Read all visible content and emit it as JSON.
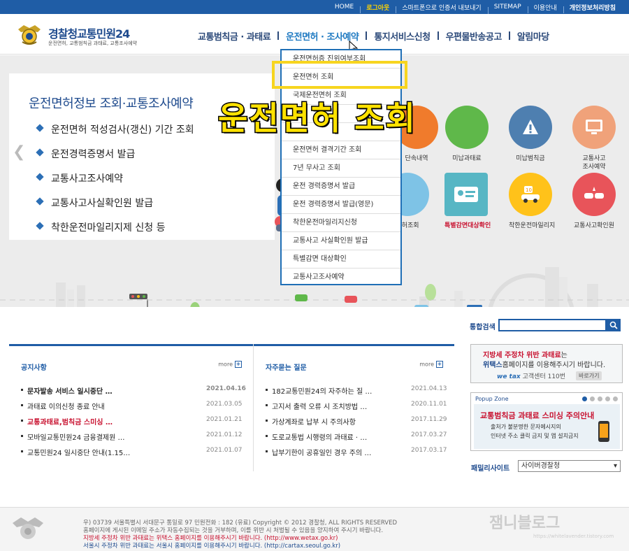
{
  "topbar": {
    "items": [
      "HOME",
      "로그아웃",
      "스마트폰으로 인증서 내보내기",
      "SITEMAP",
      "이용안내",
      "개인정보처리방침"
    ]
  },
  "logo": {
    "prefix": "경찰청",
    "name": "교통민원24",
    "sub": "운전면허, 교통범칙금 과태료, 교통조사예약"
  },
  "gnb": [
    "교통범칙금 · 과태료",
    "운전면허 · 조사예약",
    "통지서비스신청",
    "우편물반송공고",
    "알림마당"
  ],
  "hero": {
    "title": "운전면허정보 조회·교통조사예약",
    "items": [
      "운전면허 적성검사(갱신) 기간 조회",
      "운전경력증명서 발급",
      "교통사고조사예약",
      "교통사고사실확인원 발급",
      "착한운전마일리지제 신청 등"
    ]
  },
  "icons": [
    {
      "label": "단속내역",
      "color": "#f07b2c"
    },
    {
      "label": "미납과태료",
      "color": "#5fb84a"
    },
    {
      "label": "미납범칙금",
      "color": "#4e7fb0"
    },
    {
      "label": "교통사고\n조사예약",
      "color": "#f0a27a"
    },
    {
      "label": "면허조회",
      "color": "#7ec3e6"
    },
    {
      "label": "특별감면대상확인",
      "color": "#57b6c4",
      "red": true
    },
    {
      "label": "착한운전마일리지",
      "color": "#ffc21a"
    },
    {
      "label": "교통사고확인원",
      "color": "#e8545a"
    }
  ],
  "dropdown": [
    "운전면허증 진위여부조회",
    "운전면허 조회",
    "국제운전면허 조회",
    "",
    "",
    "운전면허 결격기간 조회",
    "7년 무사고 조회",
    "운전 경력증명서 발급",
    "운전 경력증명서 발급(영문)",
    "착한운전마일리지신청",
    "교통사고 사실확인원 발급",
    "특별감면 대상확인",
    "교통사고조사예약"
  ],
  "overlay": "운전면허 조회",
  "notice": {
    "title": "공지사항",
    "more": "more",
    "items": [
      {
        "text": "문자발송 서비스 일시중단 …",
        "date": "2021.04.16",
        "bold": true
      },
      {
        "text": "과태료 이의신청 종료 안내",
        "date": "2021.03.05"
      },
      {
        "text": "교통과태료,범칙금 스미싱 …",
        "date": "2021.01.21",
        "red": true
      },
      {
        "text": "모바일교통민원24 금융결제원 …",
        "date": "2021.01.12"
      },
      {
        "text": "교통민원24 일시중단 안내(1.15…",
        "date": "2021.01.07"
      }
    ]
  },
  "faq": {
    "title": "자주묻는 질문",
    "more": "more",
    "items": [
      {
        "text": "182교통민원24의 자주하는 질 …",
        "date": "2021.04.13"
      },
      {
        "text": "고지서 출력 오류 시 조치방법 …",
        "date": "2020.11.01"
      },
      {
        "text": "가상계좌로 납부 시 주의사항",
        "date": "2017.11.29"
      },
      {
        "text": "도로교통법 시행령의 과태료 · …",
        "date": "2017.03.27"
      },
      {
        "text": "납부기한이 공휴일인 경우 주의 …",
        "date": "2017.03.17"
      }
    ]
  },
  "search": {
    "label": "통합검색",
    "placeholder": ""
  },
  "ad": {
    "line1_red": "지방세 주정차 위반 과태료",
    "line1_rest": "는",
    "line2_bold": "위택스",
    "line2_rest": "홈페이지를 이용해주시기 바랍니다.",
    "brand": "we tax",
    "center": "고객센터 110번",
    "button": "바로가기"
  },
  "popup": {
    "title": "Popup Zone",
    "headline": "교통범칙금 과태료 스미싱 주의안내",
    "text1": "출처가 불분명한 문자메시지의",
    "text2": "인터넷 주소 클릭 금지 및 앱 설치금지"
  },
  "family": {
    "label": "패밀리사이트",
    "value": "사이버경찰청"
  },
  "footer": {
    "line1": "우) 03739 서울특별시 서대문구 통일로 97  민원전화 : 182 (유료)      Copyright © 2012 경찰청, ALL RIGHTS RESERVED",
    "line2": "홈페이지에 게시된 이메일 주소가 자동수집되는 것을 거부하며, 이를 위반 시 처벌될 수 있음을 양지하여 주시기 바랍니다.",
    "line3": "지방세 주정차 위반 과태료는 위택스 홈페이지를 이용해주시기 바랍니다. (http://www.wetax.go.kr)",
    "line4": "서울시 주정차 위반 과태료는 서울시 홈페이지를 이용해주시기 바랍니다. (http://cartax.seoul.go.kr)"
  },
  "watermark": {
    "title": "잼니블로그",
    "url": "https://whitelavender.tistory.com"
  }
}
